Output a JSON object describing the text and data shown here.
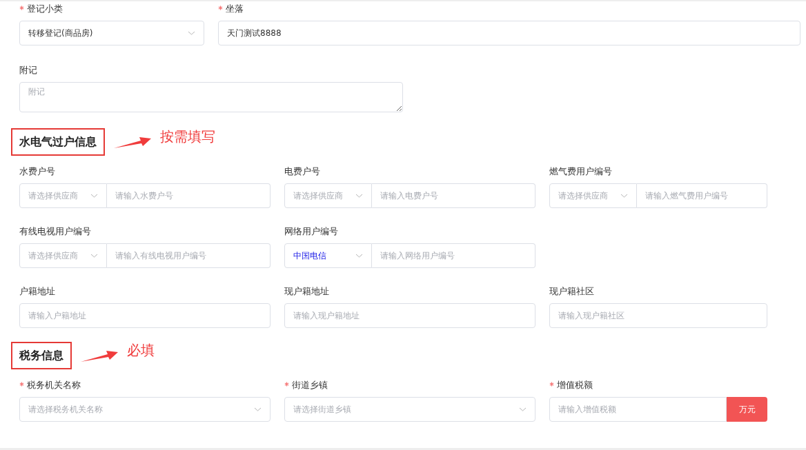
{
  "top": [
    {
      "label": "登记小类",
      "required": true,
      "kind": "select",
      "value": "转移登记(商品房)"
    },
    {
      "label": "坐落",
      "required": true,
      "kind": "input",
      "value": "天门测试8888"
    }
  ],
  "remark": {
    "label": "附记",
    "placeholder": "附记"
  },
  "sections": [
    {
      "title": "水电气过户信息",
      "note": "按需填写",
      "rows": [
        [
          {
            "label": "水费户号",
            "required": false,
            "kind": "supplier",
            "select": {
              "placeholder": "请选择供应商"
            },
            "placeholder": "请输入水费户号"
          },
          {
            "label": "电费户号",
            "required": false,
            "kind": "supplier",
            "select": {
              "placeholder": "请选择供应商"
            },
            "placeholder": "请输入电费户号"
          },
          {
            "label": "燃气费用户编号",
            "required": false,
            "kind": "supplier",
            "select": {
              "placeholder": "请选择供应商"
            },
            "placeholder": "请输入燃气费用户编号"
          }
        ],
        [
          {
            "label": "有线电视用户编号",
            "required": false,
            "kind": "supplier",
            "select": {
              "placeholder": "请选择供应商"
            },
            "placeholder": "请输入有线电视用户编号"
          },
          {
            "label": "网络用户编号",
            "required": false,
            "kind": "supplier",
            "select": {
              "value": "中国电信"
            },
            "placeholder": "请输入网络用户编号"
          }
        ],
        [
          {
            "label": "户籍地址",
            "required": false,
            "kind": "input",
            "placeholder": "请输入户籍地址"
          },
          {
            "label": "现户籍地址",
            "required": false,
            "kind": "input",
            "placeholder": "请输入现户籍地址"
          },
          {
            "label": "现户籍社区",
            "required": false,
            "kind": "input",
            "placeholder": "请输入现户籍社区"
          }
        ]
      ]
    },
    {
      "title": "税务信息",
      "note": "必填",
      "rows": [
        [
          {
            "label": "税务机关名称",
            "required": true,
            "kind": "select",
            "placeholder": "请选择税务机关名称"
          },
          {
            "label": "街道乡镇",
            "required": true,
            "kind": "select",
            "placeholder": "请选择街道乡镇"
          },
          {
            "label": "增值税额",
            "required": true,
            "kind": "unit",
            "placeholder": "请输入增值税额",
            "unit": "万元"
          }
        ]
      ]
    }
  ]
}
